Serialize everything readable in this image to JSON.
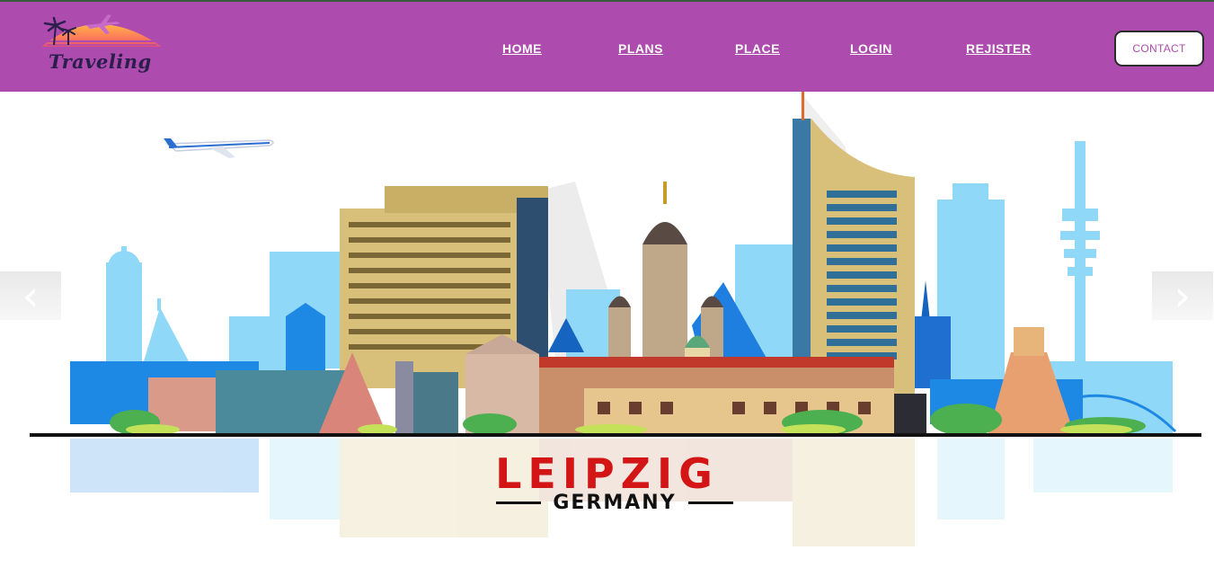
{
  "brand": {
    "name": "Traveling"
  },
  "nav": {
    "items": [
      {
        "label": "HOME"
      },
      {
        "label": "PLANS"
      },
      {
        "label": "PLACE"
      },
      {
        "label": "LOGIN"
      },
      {
        "label": "REJISTER"
      }
    ],
    "contact_label": "CONTACT"
  },
  "hero": {
    "city": "LEIPZIG",
    "country": "GERMANY",
    "prev_icon": "chevron-left-icon",
    "next_icon": "chevron-right-icon"
  },
  "colors": {
    "navbar": "#ad4bae",
    "title_red": "#d31515",
    "sky_blue": "#7fd3f5",
    "building_tan": "#d9c07a"
  }
}
